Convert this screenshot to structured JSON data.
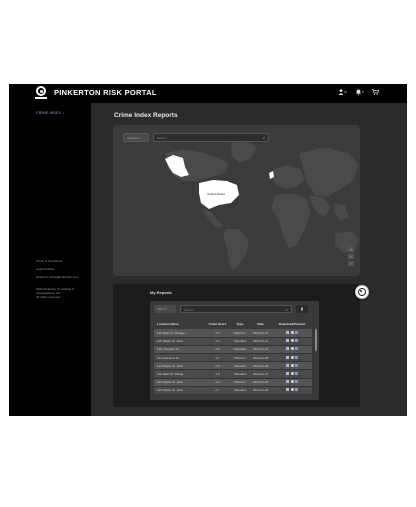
{
  "header": {
    "brand": "PINKERTON RISK PORTAL",
    "icons": [
      "user-icon",
      "bell-icon",
      "cart-icon"
    ]
  },
  "sidebar": {
    "link_label": "CRIME INDEX",
    "footer": [
      "Terms & Conditions",
      "Legal Notices",
      "pinkerton.crime@pinkerton.com",
      "2022 Pinkerton Consulting &",
      "Investigations, Inc.",
      "All rights reserved."
    ]
  },
  "main": {
    "title": "Crime Index Reports"
  },
  "map": {
    "filter_label": "Country",
    "search_placeholder": "Search",
    "zoom_in": "+",
    "zoom_out": "−",
    "selected_region_label": "United States",
    "land_color": "#4a4a4a",
    "highlight_color": "#ffffff"
  },
  "reports": {
    "title": "My Reports",
    "filter_label": "Filter",
    "search_placeholder": "Search",
    "columns": [
      "Location Name",
      "Crime Score",
      "Type",
      "Date",
      "Download/Preview"
    ],
    "rows": [
      {
        "name": "100 Main St Chicago...",
        "score": "3.5",
        "type": "Platinum",
        "date": "2022-01-12"
      },
      {
        "name": "100 Maple St. Jack...",
        "score": "3.4",
        "type": "Standard",
        "date": "2022-01-11"
      },
      {
        "name": "100 Chestnut St...",
        "score": "2.8",
        "type": "Standard",
        "date": "2022-01-10"
      },
      {
        "name": "101 Chestnut St...",
        "score": "3.1",
        "type": "Platinum",
        "date": "2022-01-09"
      },
      {
        "name": "101 Maple St. Jack...",
        "score": "2.9",
        "type": "Standard",
        "date": "2022-01-08"
      },
      {
        "name": "102 Main St Chicag...",
        "score": "3.6",
        "type": "Standard",
        "date": "2022-01-07"
      },
      {
        "name": "102 Maple St. Jack...",
        "score": "3.0",
        "type": "Platinum",
        "date": "2022-01-06"
      },
      {
        "name": "103 Maple St. Jack...",
        "score": "2.7",
        "type": "Standard",
        "date": "2022-01-05"
      }
    ]
  }
}
